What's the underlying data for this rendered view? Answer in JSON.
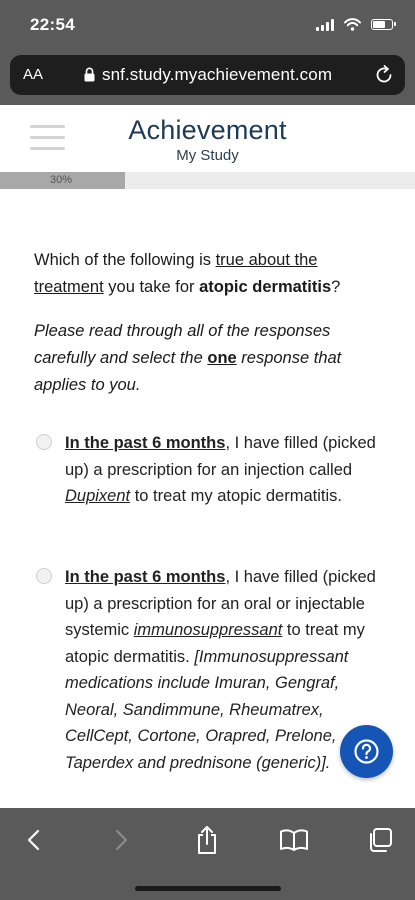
{
  "status_bar": {
    "time": "22:54"
  },
  "browser": {
    "text_size_label": "AA",
    "url": "snf.study.myachievement.com"
  },
  "site": {
    "brand_title": "Achievement",
    "brand_subtitle": "My Study"
  },
  "progress": {
    "label": "30%",
    "value": 0.3
  },
  "question": {
    "part1": "Which of the following is ",
    "part2": "true about the treatment",
    "part3": " you take for ",
    "part4": "atopic dermatitis",
    "part5": "?"
  },
  "instructions": {
    "part1": "Please read through all of the responses carefully and select the ",
    "part2": "one",
    "part3": " response that applies to you."
  },
  "options": [
    {
      "lead": "In the past 6 months",
      "t1": ", I have filled (picked up) a prescription for an injection called ",
      "drug": "Dupixent",
      "t2": " to treat my atopic dermatitis."
    },
    {
      "lead": "In the past 6 months",
      "t1": ", I have filled (picked up) a prescription for an oral or injectable systemic ",
      "drug": "immunosuppressant",
      "t2": " to treat my atopic dermatitis.",
      "note": "[Immunosuppressant medications include Imuran, Gengraf, Neoral, Sandimmune, Rheumatrex, CellCept, Cortone, Orapred, Prelone, Taperdex and prednisone (generic)]."
    }
  ],
  "colors": {
    "brand": "#1d3a56",
    "help_button": "#1555b5",
    "chrome": "#5a5a5a"
  },
  "icons": [
    "signal-icon",
    "wifi-icon",
    "battery-icon",
    "lock-icon",
    "reload-icon",
    "menu-icon",
    "help-icon",
    "back-icon",
    "forward-icon",
    "share-icon",
    "bookmarks-icon",
    "tabs-icon"
  ]
}
